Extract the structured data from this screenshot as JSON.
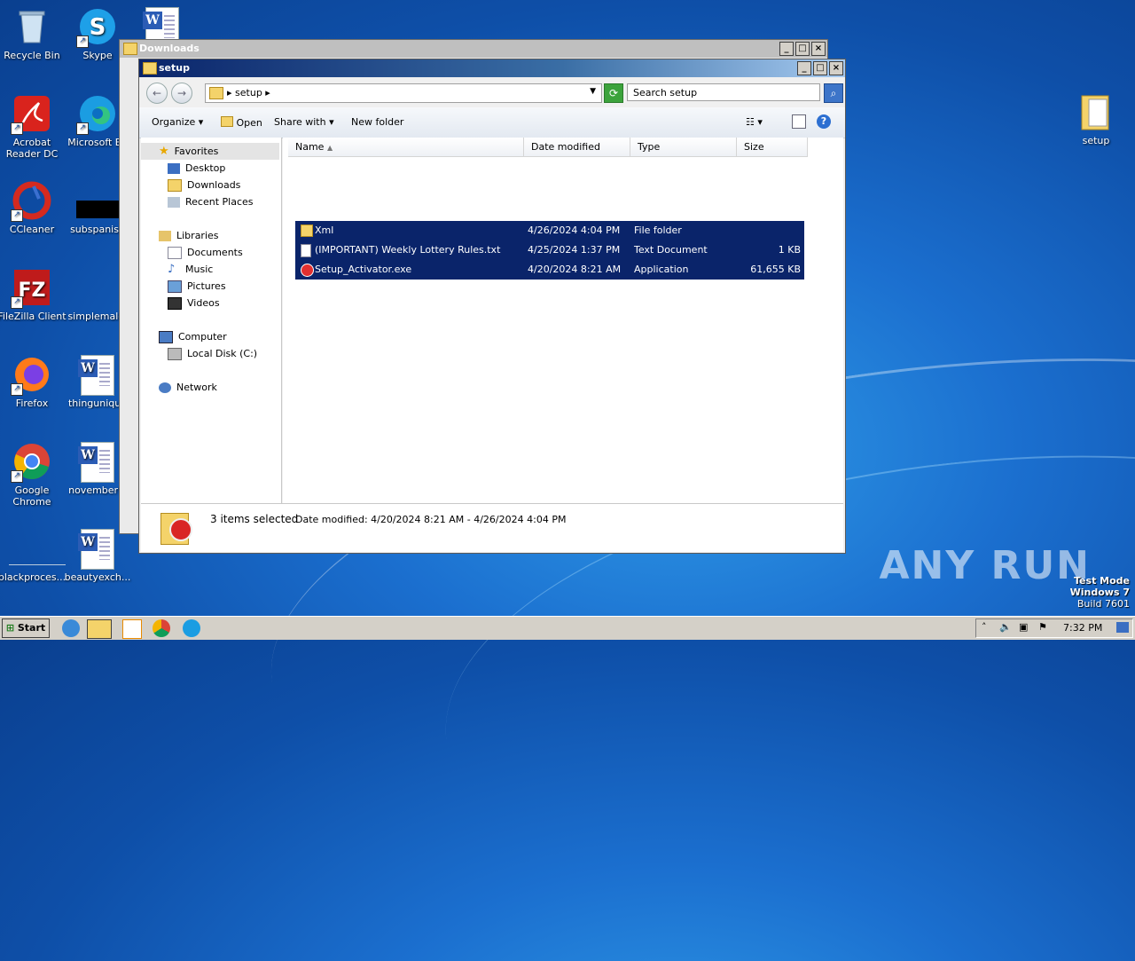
{
  "desktop": {
    "icons": [
      {
        "label": "Recycle Bin"
      },
      {
        "label": "Skype"
      },
      {
        "label": "Acrobat Reader DC"
      },
      {
        "label": "Microsoft Ed"
      },
      {
        "label": "CCleaner"
      },
      {
        "label": "subspanish"
      },
      {
        "label": "FileZilla Client"
      },
      {
        "label": "simplemale."
      },
      {
        "label": "Firefox"
      },
      {
        "label": "thingunique"
      },
      {
        "label": "Google Chrome"
      },
      {
        "label": "novemberlo"
      },
      {
        "label": "blackproces..."
      },
      {
        "label": "beautyexch..."
      },
      {
        "label": "setup"
      }
    ],
    "watermark": "ANY RUN",
    "test_mode": {
      "line1": "Test Mode",
      "line2": "Windows 7",
      "line3": "Build 7601"
    }
  },
  "back_window": {
    "title": "Downloads"
  },
  "window": {
    "title": "setup",
    "address": {
      "crumb": "setup"
    },
    "search": {
      "placeholder": "Search setup"
    },
    "toolbar": {
      "organize": "Organize",
      "open": "Open",
      "share_with": "Share with",
      "new_folder": "New folder"
    },
    "nav": {
      "favorites": "Favorites",
      "desktop": "Desktop",
      "downloads": "Downloads",
      "recent_places": "Recent Places",
      "libraries": "Libraries",
      "documents": "Documents",
      "music": "Music",
      "pictures": "Pictures",
      "videos": "Videos",
      "computer": "Computer",
      "local_disk": "Local Disk (C:)",
      "network": "Network"
    },
    "columns": {
      "name": "Name",
      "date": "Date modified",
      "type": "Type",
      "size": "Size"
    },
    "files": [
      {
        "name": "Xml",
        "date": "4/26/2024 4:04 PM",
        "type": "File folder",
        "size": ""
      },
      {
        "name": "(IMPORTANT) Weekly Lottery Rules.txt",
        "date": "4/25/2024 1:37 PM",
        "type": "Text Document",
        "size": "1 KB"
      },
      {
        "name": "Setup_Activator.exe",
        "date": "4/20/2024 8:21 AM",
        "type": "Application",
        "size": "61,655 KB"
      }
    ],
    "status": {
      "selected": "3 items selected",
      "date_range": "Date modified: 4/20/2024 8:21 AM - 4/26/2024 4:04 PM"
    }
  },
  "taskbar": {
    "start": "Start",
    "clock": "7:32 PM"
  }
}
